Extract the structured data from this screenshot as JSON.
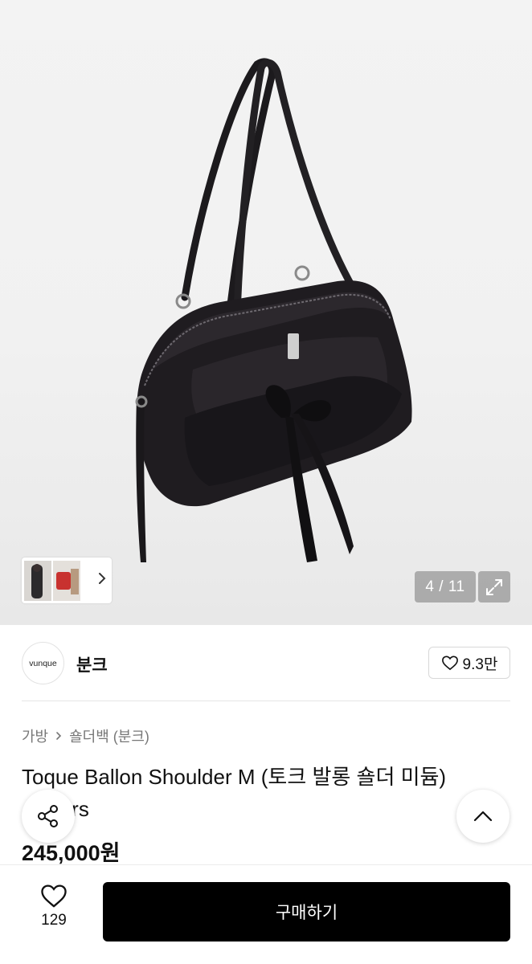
{
  "gallery": {
    "counter": "4 / 11",
    "current": 4,
    "total": 11
  },
  "icons": {
    "next": "chevron-right-icon",
    "expand": "expand-icon",
    "heart": "heart-icon",
    "share": "share-icon",
    "scroll_top": "chevron-up-icon",
    "breadcrumb_sep": "chevron-right-icon"
  },
  "shop": {
    "logo_text": "vunque",
    "name": "분크",
    "follow_count": "9.3만"
  },
  "breadcrumb": {
    "category": "가방",
    "subcategory": "숄더백 (분크)"
  },
  "product": {
    "title": "Toque Ballon Shoulder M (토크 발롱 숄더 미듐) 4colors",
    "price": "245,000원"
  },
  "bottom_bar": {
    "like_count": "129",
    "buy_label": "구매하기"
  },
  "colors": {
    "buy_button": "#000000",
    "counter_bg": "#7f7f7f"
  }
}
